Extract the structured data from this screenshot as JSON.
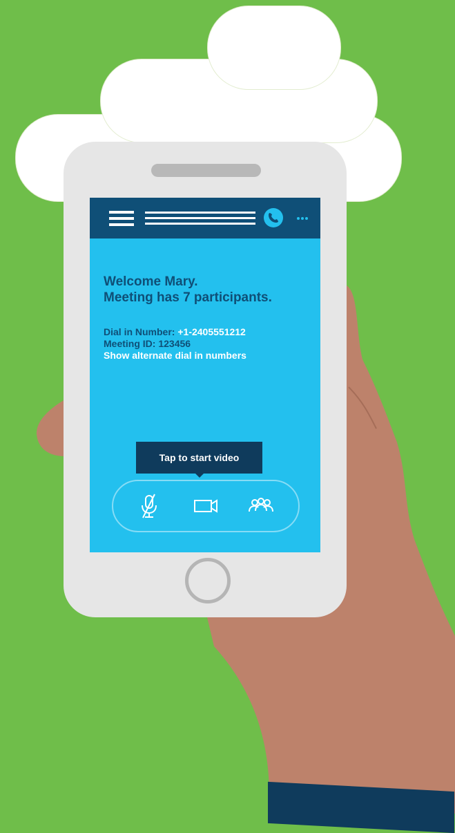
{
  "colors": {
    "background": "#6fbe4a",
    "phone_body": "#e6e6e6",
    "screen": "#23c0ee",
    "header": "#0f4f77",
    "tooltip": "#0f3b5c",
    "skin": "#bd826b"
  },
  "header": {
    "menu_icon": "hamburger-menu-icon",
    "call_icon": "phone-call-icon",
    "more_icon": "more-dots-icon"
  },
  "welcome": {
    "line1": "Welcome Mary.",
    "line2": "Meeting has 7 participants."
  },
  "dial_info": {
    "dial_label": "Dial in Number:",
    "dial_value": "+1-2405551212",
    "meeting_id_label": "Meeting ID:",
    "meeting_id_value": "123456",
    "alternate_link": "Show alternate dial in numbers"
  },
  "tooltip": {
    "text": "Tap to start video"
  },
  "controls": {
    "mute_icon": "microphone-muted-icon",
    "video_icon": "video-camera-icon",
    "participants_icon": "participants-icon"
  }
}
